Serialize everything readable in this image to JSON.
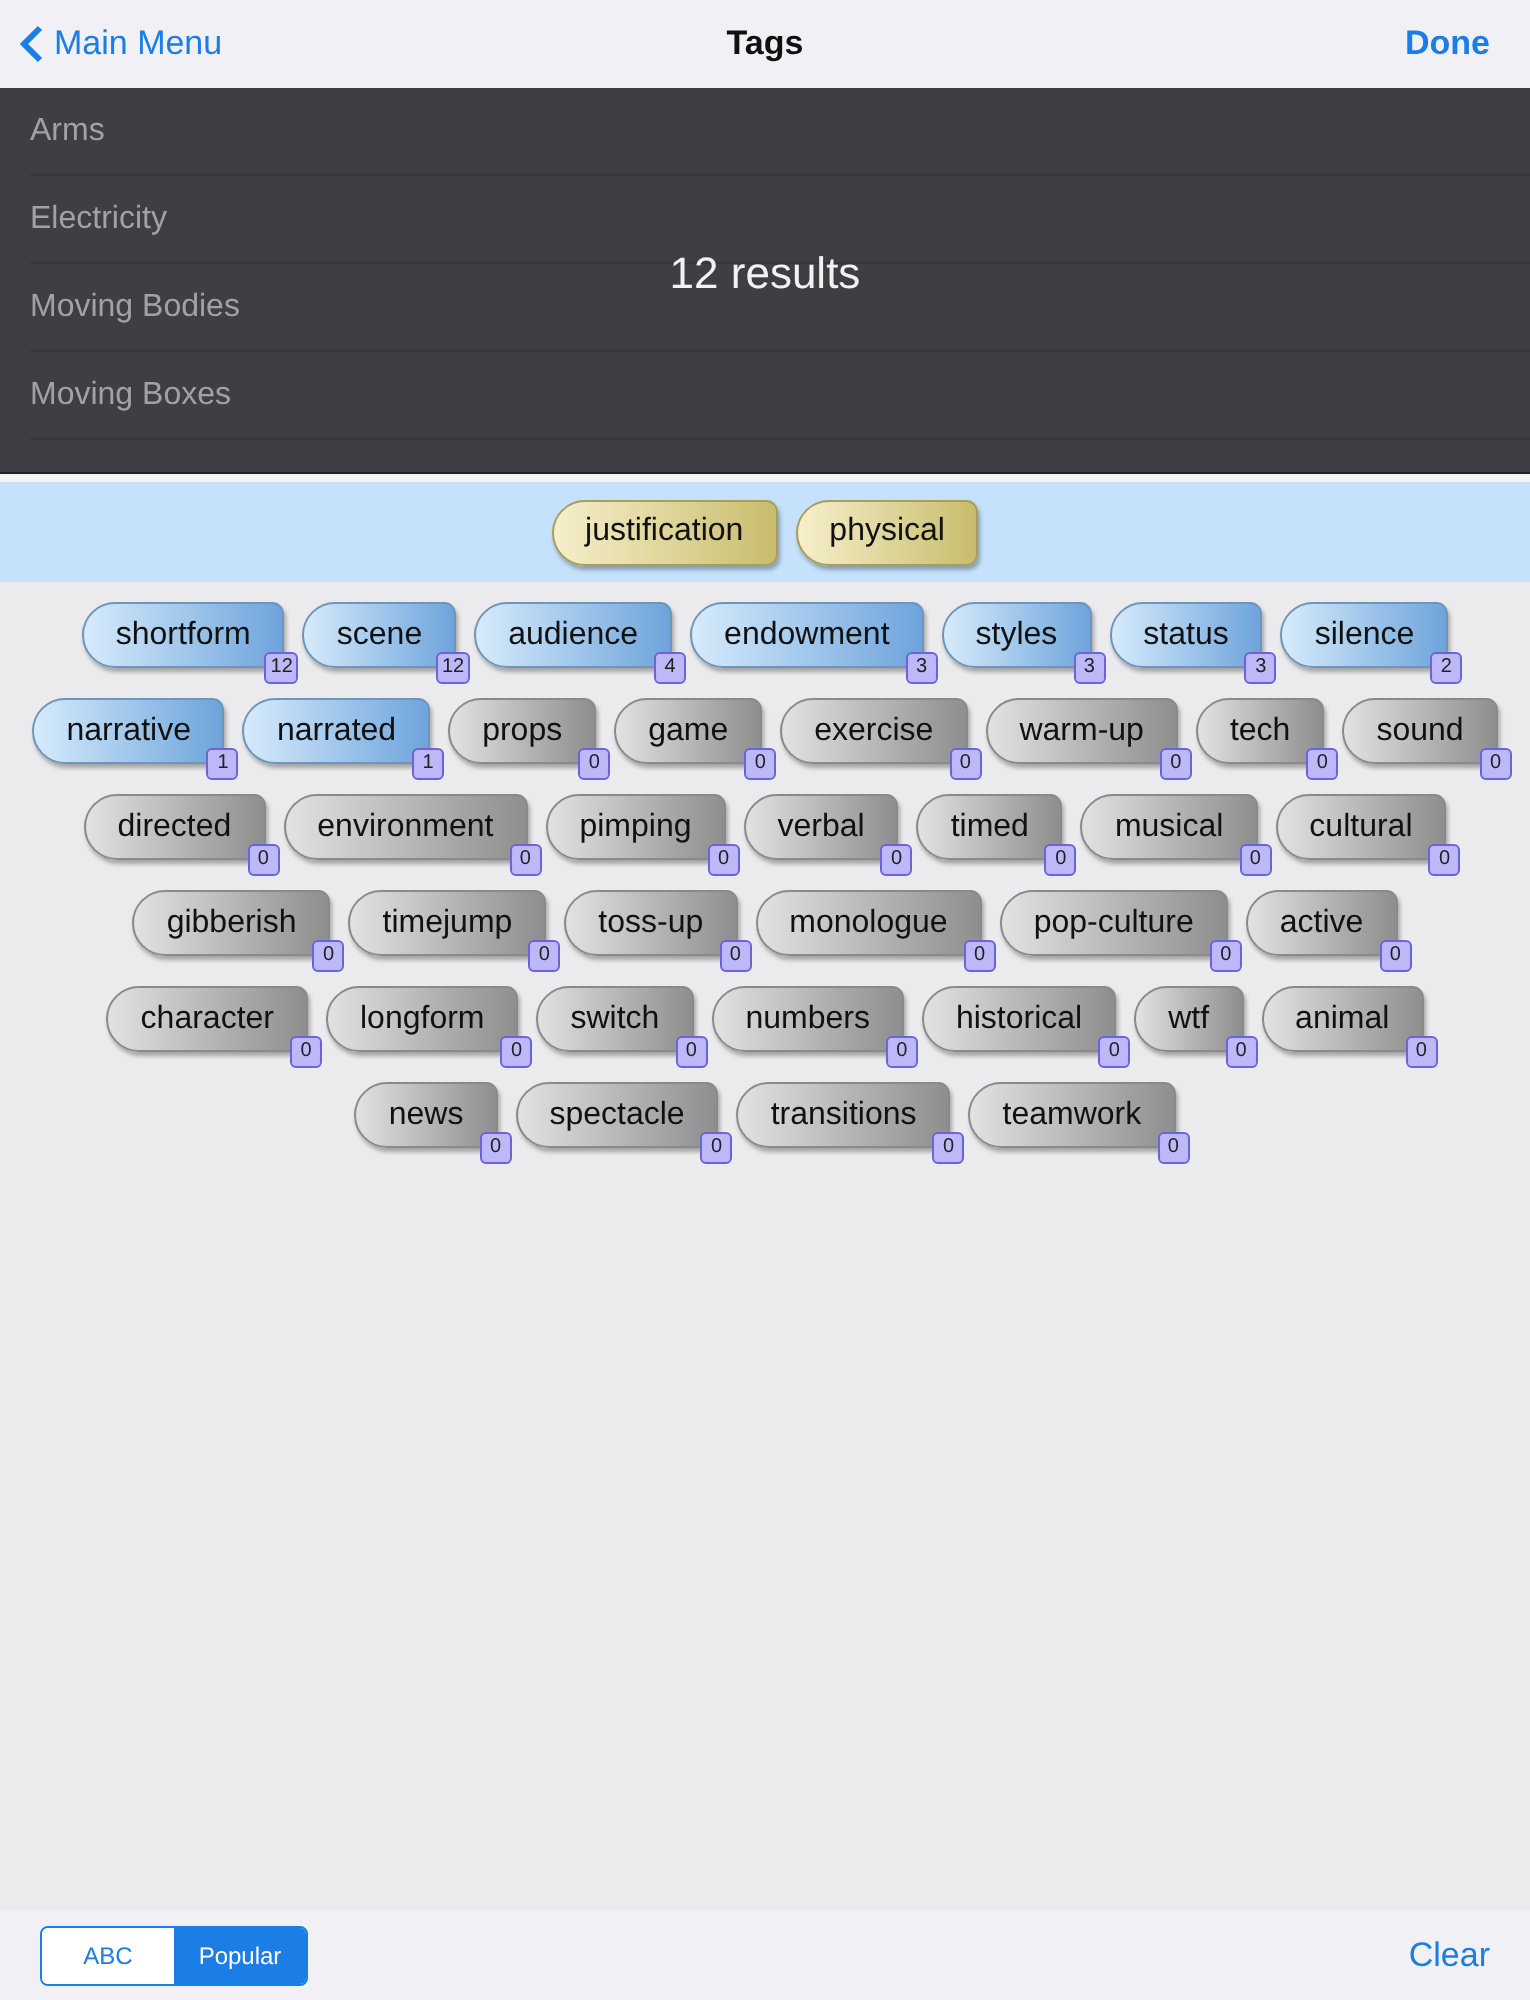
{
  "nav": {
    "back": "Main Menu",
    "title": "Tags",
    "done": "Done"
  },
  "list": {
    "items": [
      "Arms",
      "Electricity",
      "Moving Bodies",
      "Moving Boxes"
    ],
    "overlay": "12 results"
  },
  "selected_tags": [
    "justification",
    "physical"
  ],
  "tag_rows": [
    [
      {
        "label": "shortform",
        "count": "12",
        "matched": true
      },
      {
        "label": "scene",
        "count": "12",
        "matched": true
      },
      {
        "label": "audience",
        "count": "4",
        "matched": true
      },
      {
        "label": "endowment",
        "count": "3",
        "matched": true
      },
      {
        "label": "styles",
        "count": "3",
        "matched": true
      },
      {
        "label": "status",
        "count": "3",
        "matched": true
      },
      {
        "label": "silence",
        "count": "2",
        "matched": true
      }
    ],
    [
      {
        "label": "narrative",
        "count": "1",
        "matched": true
      },
      {
        "label": "narrated",
        "count": "1",
        "matched": true
      },
      {
        "label": "props",
        "count": "0",
        "matched": false
      },
      {
        "label": "game",
        "count": "0",
        "matched": false
      },
      {
        "label": "exercise",
        "count": "0",
        "matched": false
      },
      {
        "label": "warm-up",
        "count": "0",
        "matched": false
      },
      {
        "label": "tech",
        "count": "0",
        "matched": false
      },
      {
        "label": "sound",
        "count": "0",
        "matched": false
      }
    ],
    [
      {
        "label": "directed",
        "count": "0",
        "matched": false
      },
      {
        "label": "environment",
        "count": "0",
        "matched": false
      },
      {
        "label": "pimping",
        "count": "0",
        "matched": false
      },
      {
        "label": "verbal",
        "count": "0",
        "matched": false
      },
      {
        "label": "timed",
        "count": "0",
        "matched": false
      },
      {
        "label": "musical",
        "count": "0",
        "matched": false
      },
      {
        "label": "cultural",
        "count": "0",
        "matched": false
      }
    ],
    [
      {
        "label": "gibberish",
        "count": "0",
        "matched": false
      },
      {
        "label": "timejump",
        "count": "0",
        "matched": false
      },
      {
        "label": "toss-up",
        "count": "0",
        "matched": false
      },
      {
        "label": "monologue",
        "count": "0",
        "matched": false
      },
      {
        "label": "pop-culture",
        "count": "0",
        "matched": false
      },
      {
        "label": "active",
        "count": "0",
        "matched": false
      }
    ],
    [
      {
        "label": "character",
        "count": "0",
        "matched": false
      },
      {
        "label": "longform",
        "count": "0",
        "matched": false
      },
      {
        "label": "switch",
        "count": "0",
        "matched": false
      },
      {
        "label": "numbers",
        "count": "0",
        "matched": false
      },
      {
        "label": "historical",
        "count": "0",
        "matched": false
      },
      {
        "label": "wtf",
        "count": "0",
        "matched": false
      },
      {
        "label": "animal",
        "count": "0",
        "matched": false
      }
    ],
    [
      {
        "label": "news",
        "count": "0",
        "matched": false
      },
      {
        "label": "spectacle",
        "count": "0",
        "matched": false
      },
      {
        "label": "transitions",
        "count": "0",
        "matched": false
      },
      {
        "label": "teamwork",
        "count": "0",
        "matched": false
      }
    ]
  ],
  "sort_options": [
    {
      "label": "ABC",
      "selected": false
    },
    {
      "label": "Popular",
      "selected": true
    }
  ],
  "clear": "Clear"
}
